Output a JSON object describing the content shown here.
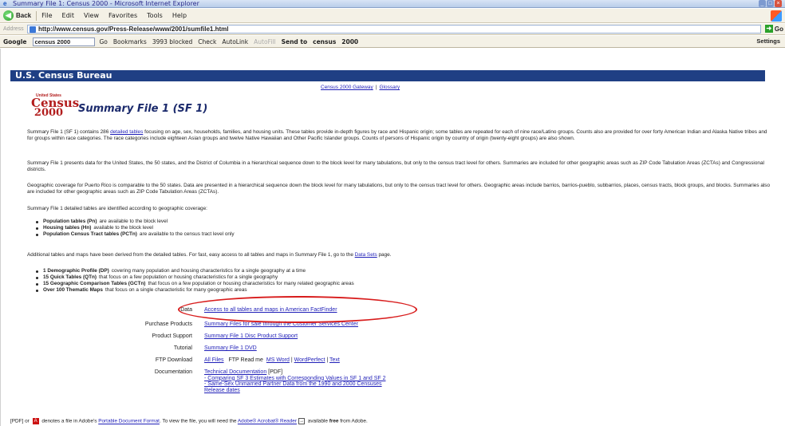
{
  "window": {
    "title": "Summary File 1: Census 2000 - Microsoft Internet Explorer"
  },
  "menubar": {
    "back_label": "Back",
    "items": [
      "File",
      "Edit",
      "View",
      "Favorites",
      "Tools",
      "Help"
    ]
  },
  "address": {
    "label": "Address",
    "url": "http://www.census.gov/Press-Release/www/2001/sumfile1.html",
    "go_label": "Go"
  },
  "googlebar": {
    "logo": "Google",
    "search_value": "census 2000",
    "go_label": "Go",
    "bookmarks_label": "Bookmarks",
    "blocked_label": "3993 blocked",
    "check_label": "Check",
    "autolink_label": "AutoLink",
    "autofill_label": "AutoFill",
    "sendto_label": "Send to",
    "term1": "census",
    "term2": "2000",
    "settings_label": "Settings"
  },
  "page": {
    "header_title": "U.S. Census Bureau",
    "top_links": [
      "Census 2000 Gateway",
      "Glossary"
    ],
    "logo_small": "United States",
    "logo_line1": "Census",
    "logo_line2": "2000",
    "title": "Summary File 1 (SF 1)",
    "p1_pre": "Summary File 1 (SF 1) contains 286 ",
    "p1_link": "detailed tables",
    "p1_post": " focusing on age, sex, households, families, and housing units. These tables provide in-depth figures by race and Hispanic origin; some tables are repeated for each of nine race/Latino groups. Counts also are provided for over forty American Indian and Alaska Native tribes and for groups within race categories. The race categories include eighteen Asian groups and twelve Native Hawaiian and Other Pacific Islander groups. Counts of persons of Hispanic origin by country of origin (twenty-eight groups) are also shown.",
    "p2": "Summary File 1 presents data for the United States, the 50 states, and the District of Columbia in a hierarchical sequence down to the block level for many tabulations, but only to the census tract level for others. Summaries are included for other geographic areas such as ZIP Code Tabulation Areas (ZCTAs) and Congressional districts.",
    "p3": "Geographic coverage for Puerto Rico is comparable to the 50 states. Data are presented in a hierarchical sequence down the block level for many tabulations, but only to the census tract level for others. Geographic areas include barrios, barrios-pueblo, subbarrios, places, census tracts, block groups, and blocks. Summaries also are included for other geographic areas such as ZIP Code Tabulation Areas (ZCTAs).",
    "p4": "Summary File 1 detailed tables are identified according to geographic coverage:",
    "bullets1": [
      {
        "bold": "Population tables (Pn)",
        "rest": "are available to the block level"
      },
      {
        "bold": "Housing tables (Hn)",
        "rest": "available to the block level"
      },
      {
        "bold": "Population Census Tract tables (PCTn)",
        "rest": "are available to the census tract level only"
      }
    ],
    "p5_pre": "Additional tables and maps have been derived from the detailed tables. For fast, easy access to all tables and maps in Summary File 1, go to the ",
    "p5_link": "Data Sets",
    "p5_post": " page.",
    "bullets2": [
      {
        "bold": "1 Demographic Profile (DP)",
        "rest": "covering many population and housing characteristics for a single geography at a time"
      },
      {
        "bold": "15 Quick Tables (QTn)",
        "rest": "that focus on a few population or housing characteristics for a single geography"
      },
      {
        "bold": "15 Geographic Comparison Tables (GCTn)",
        "rest": "that focus on a few population or housing characteristics for many related geographic areas"
      },
      {
        "bold": "Over 100 Thematic Maps",
        "rest": "that focus on a single characteristic for many geographic areas"
      }
    ],
    "rows": {
      "data_k": "Data",
      "data_v": "Access to all tables and maps in American FactFinder",
      "purchase_k": "Purchase Products",
      "purchase_v": "Summary Files for sale through the Customer Services Center",
      "support_k": "Product Support",
      "support_v": "Summary File 1 Disc Product Support",
      "tutorial_k": "Tutorial",
      "tutorial_v": "Summary File 1 DVD",
      "ftp_k": "FTP Download",
      "ftp_all": "All Files",
      "ftp_readme": "FTP Read me",
      "ftp_msword": "MS Word",
      "ftp_wp": "WordPerfect",
      "ftp_text": "Text",
      "doc_k": "Documentation",
      "doc_tech": "Technical Documentation",
      "doc_tech_suffix": "[PDF]",
      "doc_l2": "- Comparing SF 3 Estimates with Corresponding Values in SF 1 and SF 2",
      "doc_l3": "- Same-Sex Unmarried Partner Data from the 1990 and 2000 Censuses",
      "doc_l4": "Release dates"
    },
    "footer_pre": "[PDF] or ",
    "footer_mid": " denotes a file in Adobe's ",
    "footer_link1": "Portable Document Format",
    "footer_mid2": ". To view the file, you will need the ",
    "footer_link2": "Adobe® Acrobat® Reader",
    "footer_post_pre": " available ",
    "footer_free": "free",
    "footer_post": " from Adobe."
  },
  "colors": {
    "header_bg": "#1f3f84",
    "link": "#1f1fb8",
    "highlight_circle": "#d81c1c",
    "logo_red": "#b21d1d"
  }
}
